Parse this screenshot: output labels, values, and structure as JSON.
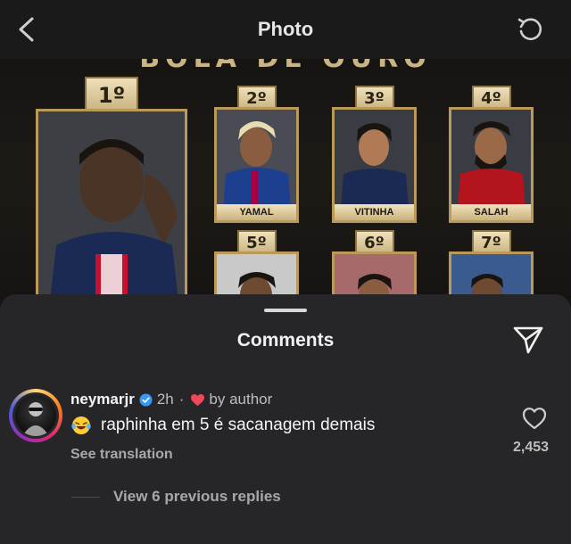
{
  "header": {
    "title": "Photo",
    "back_icon": "chevron-left-icon",
    "refresh_icon": "refresh-icon"
  },
  "photo": {
    "heading_partial": "BOLA DE OURO",
    "cards": [
      {
        "rank": "1º",
        "name": ""
      },
      {
        "rank": "2º",
        "name": "YAMAL"
      },
      {
        "rank": "3º",
        "name": "VITINHA"
      },
      {
        "rank": "4º",
        "name": "SALAH"
      },
      {
        "rank": "5º",
        "name": ""
      },
      {
        "rank": "6º",
        "name": ""
      },
      {
        "rank": "7º",
        "name": ""
      }
    ],
    "colors": {
      "gold": "#b99a5b",
      "psg_navy": "#1b2a55",
      "psg_red": "#c8102e",
      "barca_blue": "#1c3f8f",
      "liverpool_red": "#b3141d"
    }
  },
  "comments_sheet": {
    "title": "Comments",
    "share_icon": "send-icon",
    "comment": {
      "username": "neymarjr",
      "verified": true,
      "time": "2h",
      "separator": "·",
      "liked_by_author": "by author",
      "emoji": "laughing-tears-emoji",
      "text": "raphinha em 5 é sacanagem demais",
      "see_translation": "See translation",
      "like_count": "2,453"
    },
    "view_replies": "View 6 previous replies"
  },
  "colors": {
    "sheet_bg": "#262629",
    "verified_blue": "#3897f0",
    "heart_red": "#ed4956",
    "muted_text": "#a8a8a8"
  }
}
